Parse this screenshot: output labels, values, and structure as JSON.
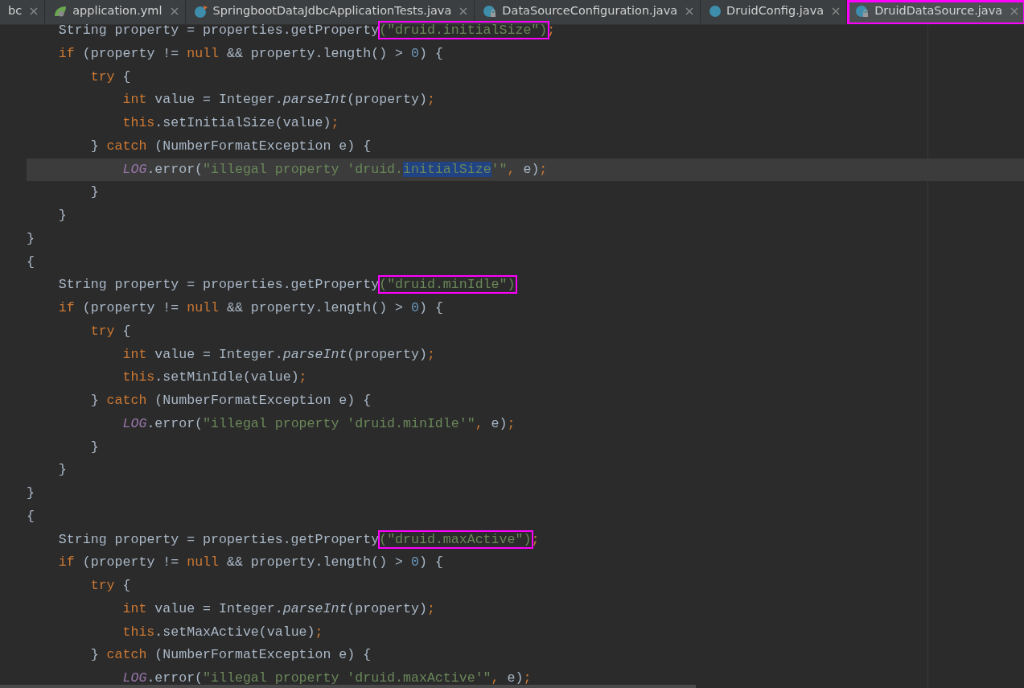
{
  "tabs": [
    {
      "label": "bc",
      "kind": "plain",
      "selected": false,
      "boxed": false
    },
    {
      "label": "application.yml",
      "kind": "config",
      "selected": false,
      "boxed": false
    },
    {
      "label": "SpringbootDataJdbcApplicationTests.java",
      "kind": "test",
      "selected": false,
      "boxed": false
    },
    {
      "label": "DataSourceConfiguration.java",
      "kind": "locked",
      "selected": false,
      "boxed": false
    },
    {
      "label": "DruidConfig.java",
      "kind": "class",
      "selected": false,
      "boxed": false
    },
    {
      "label": "DruidDataSource.java",
      "kind": "locked",
      "selected": true,
      "boxed": true
    }
  ],
  "code_lines": [
    {
      "current": false,
      "tokens": [
        {
          "kind": "plain",
          "text": "    String property = properties.getProperty"
        },
        {
          "kind": "string",
          "text": "(\"druid.initialSize\")",
          "boxed": true
        },
        {
          "kind": "keyword",
          "text": ";"
        }
      ]
    },
    {
      "current": false,
      "tokens": [
        {
          "kind": "keyword",
          "text": "    if "
        },
        {
          "kind": "plain",
          "text": "(property != "
        },
        {
          "kind": "keyword",
          "text": "null "
        },
        {
          "kind": "plain",
          "text": "&& property.length() > "
        },
        {
          "kind": "number",
          "text": "0"
        },
        {
          "kind": "plain",
          "text": ") {"
        }
      ]
    },
    {
      "current": false,
      "tokens": [
        {
          "kind": "keyword",
          "text": "        try "
        },
        {
          "kind": "plain",
          "text": "{"
        }
      ]
    },
    {
      "current": false,
      "tokens": [
        {
          "kind": "keyword",
          "text": "            int "
        },
        {
          "kind": "plain",
          "text": "value = Integer."
        },
        {
          "kind": "italic",
          "text": "parseInt"
        },
        {
          "kind": "plain",
          "text": "(property)"
        },
        {
          "kind": "keyword",
          "text": ";"
        }
      ]
    },
    {
      "current": false,
      "tokens": [
        {
          "kind": "keyword",
          "text": "            this"
        },
        {
          "kind": "plain",
          "text": ".setInitialSize(value)"
        },
        {
          "kind": "keyword",
          "text": ";"
        }
      ]
    },
    {
      "current": false,
      "tokens": [
        {
          "kind": "plain",
          "text": "        } "
        },
        {
          "kind": "keyword",
          "text": "catch "
        },
        {
          "kind": "plain",
          "text": "(NumberFormatException e) {"
        }
      ]
    },
    {
      "current": true,
      "tokens": [
        {
          "kind": "static",
          "text": "            LOG"
        },
        {
          "kind": "plain",
          "text": ".error("
        },
        {
          "kind": "string",
          "text": "\"illegal property 'druid."
        },
        {
          "kind": "string",
          "text": "initialSize",
          "selected": true
        },
        {
          "kind": "string",
          "text": "'\""
        },
        {
          "kind": "keyword",
          "text": ", "
        },
        {
          "kind": "plain",
          "text": "e)"
        },
        {
          "kind": "keyword",
          "text": ";"
        }
      ]
    },
    {
      "current": false,
      "tokens": [
        {
          "kind": "plain",
          "text": "        }"
        }
      ]
    },
    {
      "current": false,
      "tokens": [
        {
          "kind": "plain",
          "text": "    }"
        }
      ]
    },
    {
      "current": false,
      "tokens": [
        {
          "kind": "plain",
          "text": "}"
        }
      ]
    },
    {
      "current": false,
      "tokens": [
        {
          "kind": "plain",
          "text": "{"
        }
      ]
    },
    {
      "current": false,
      "tokens": [
        {
          "kind": "plain",
          "text": "    String property = properties.getProperty"
        },
        {
          "kind": "string",
          "text": "(\"druid.minIdle\")",
          "boxed": true
        }
      ]
    },
    {
      "current": false,
      "tokens": [
        {
          "kind": "keyword",
          "text": "    if "
        },
        {
          "kind": "plain",
          "text": "(property != "
        },
        {
          "kind": "keyword",
          "text": "null "
        },
        {
          "kind": "plain",
          "text": "&& property.length() > "
        },
        {
          "kind": "number",
          "text": "0"
        },
        {
          "kind": "plain",
          "text": ") {"
        }
      ]
    },
    {
      "current": false,
      "tokens": [
        {
          "kind": "keyword",
          "text": "        try "
        },
        {
          "kind": "plain",
          "text": "{"
        }
      ]
    },
    {
      "current": false,
      "tokens": [
        {
          "kind": "keyword",
          "text": "            int "
        },
        {
          "kind": "plain",
          "text": "value = Integer."
        },
        {
          "kind": "italic",
          "text": "parseInt"
        },
        {
          "kind": "plain",
          "text": "(property)"
        },
        {
          "kind": "keyword",
          "text": ";"
        }
      ]
    },
    {
      "current": false,
      "tokens": [
        {
          "kind": "keyword",
          "text": "            this"
        },
        {
          "kind": "plain",
          "text": ".setMinIdle(value)"
        },
        {
          "kind": "keyword",
          "text": ";"
        }
      ]
    },
    {
      "current": false,
      "tokens": [
        {
          "kind": "plain",
          "text": "        } "
        },
        {
          "kind": "keyword",
          "text": "catch "
        },
        {
          "kind": "plain",
          "text": "(NumberFormatException e) {"
        }
      ]
    },
    {
      "current": false,
      "tokens": [
        {
          "kind": "static",
          "text": "            LOG"
        },
        {
          "kind": "plain",
          "text": ".error("
        },
        {
          "kind": "string",
          "text": "\"illegal property 'druid.minIdle'\""
        },
        {
          "kind": "keyword",
          "text": ", "
        },
        {
          "kind": "plain",
          "text": "e)"
        },
        {
          "kind": "keyword",
          "text": ";"
        }
      ]
    },
    {
      "current": false,
      "tokens": [
        {
          "kind": "plain",
          "text": "        }"
        }
      ]
    },
    {
      "current": false,
      "tokens": [
        {
          "kind": "plain",
          "text": "    }"
        }
      ]
    },
    {
      "current": false,
      "tokens": [
        {
          "kind": "plain",
          "text": "}"
        }
      ]
    },
    {
      "current": false,
      "tokens": [
        {
          "kind": "plain",
          "text": "{"
        }
      ]
    },
    {
      "current": false,
      "tokens": [
        {
          "kind": "plain",
          "text": "    String property = properties.getProperty"
        },
        {
          "kind": "string",
          "text": "(\"druid.maxActive\")",
          "boxed": true
        },
        {
          "kind": "keyword",
          "text": ";"
        }
      ]
    },
    {
      "current": false,
      "tokens": [
        {
          "kind": "keyword",
          "text": "    if "
        },
        {
          "kind": "plain",
          "text": "(property != "
        },
        {
          "kind": "keyword",
          "text": "null "
        },
        {
          "kind": "plain",
          "text": "&& property.length() > "
        },
        {
          "kind": "number",
          "text": "0"
        },
        {
          "kind": "plain",
          "text": ") {"
        }
      ]
    },
    {
      "current": false,
      "tokens": [
        {
          "kind": "keyword",
          "text": "        try "
        },
        {
          "kind": "plain",
          "text": "{"
        }
      ]
    },
    {
      "current": false,
      "tokens": [
        {
          "kind": "keyword",
          "text": "            int "
        },
        {
          "kind": "plain",
          "text": "value = Integer."
        },
        {
          "kind": "italic",
          "text": "parseInt"
        },
        {
          "kind": "plain",
          "text": "(property)"
        },
        {
          "kind": "keyword",
          "text": ";"
        }
      ]
    },
    {
      "current": false,
      "tokens": [
        {
          "kind": "keyword",
          "text": "            this"
        },
        {
          "kind": "plain",
          "text": ".setMaxActive(value)"
        },
        {
          "kind": "keyword",
          "text": ";"
        }
      ]
    },
    {
      "current": false,
      "tokens": [
        {
          "kind": "plain",
          "text": "        } "
        },
        {
          "kind": "keyword",
          "text": "catch "
        },
        {
          "kind": "plain",
          "text": "(NumberFormatException e) {"
        }
      ]
    },
    {
      "current": false,
      "tokens": [
        {
          "kind": "static",
          "text": "            LOG"
        },
        {
          "kind": "plain",
          "text": ".error("
        },
        {
          "kind": "string",
          "text": "\"illegal property 'druid.maxActive'\""
        },
        {
          "kind": "keyword",
          "text": ", "
        },
        {
          "kind": "plain",
          "text": "e)"
        },
        {
          "kind": "keyword",
          "text": ";"
        }
      ]
    }
  ]
}
